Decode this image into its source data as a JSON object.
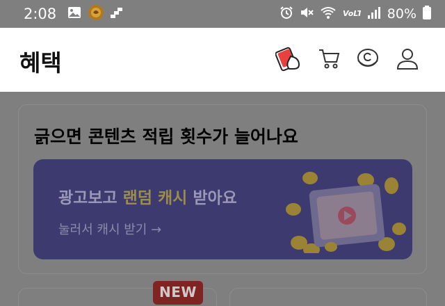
{
  "status_bar": {
    "time": "2:08",
    "battery_percent": "80%",
    "network_label": "Vo LTE",
    "left_icons": [
      "gallery-icon",
      "app-coin-icon",
      "app-block-icon"
    ],
    "right_icons": [
      "alarm-icon",
      "mute-icon",
      "wifi-icon",
      "volte-icon",
      "signal-icon",
      "battery-icon"
    ]
  },
  "header": {
    "title": "혜택",
    "icons": [
      "card-stamp-icon",
      "cart-icon",
      "coin-c-icon",
      "user-icon"
    ],
    "accent_color": "#e8413f"
  },
  "main": {
    "card_title": "긁으면 콘텐츠 적립 횟수가 늘어나요",
    "banner": {
      "heading_prefix": "광고보고 ",
      "heading_highlight": "랜덤 캐시",
      "heading_suffix": " 받아요",
      "link_text": "눌러서 캐시 받기 →",
      "background_color": "#3c3a6e",
      "highlight_color": "#9a8e49"
    },
    "new_badge": "NEW"
  },
  "overlay_color": "#7f7f7f"
}
